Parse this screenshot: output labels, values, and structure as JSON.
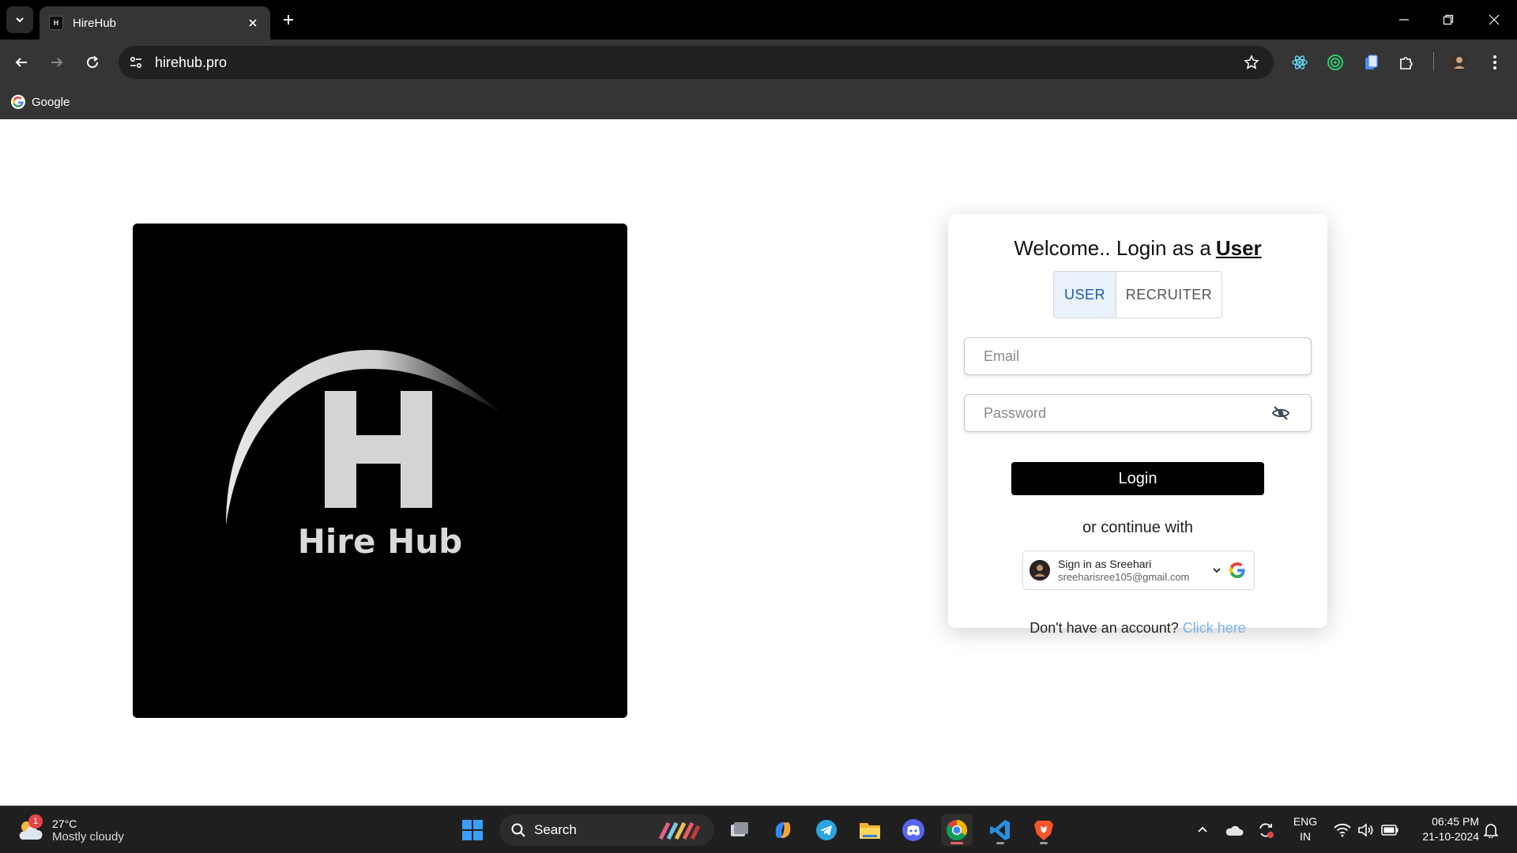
{
  "browser": {
    "tab_title": "HireHub",
    "tab_favicon_text": "H",
    "url": "hirehub.pro",
    "bookmarks": [
      {
        "label": "Google"
      }
    ],
    "icons": {
      "tab_menu": "chevron-down-icon",
      "tab_close": "close-icon",
      "new_tab": "plus-icon",
      "back": "arrow-left-icon",
      "forward": "arrow-right-icon",
      "reload": "reload-icon",
      "site_info": "tune-icon",
      "bookmark_star": "star-icon",
      "extensions": [
        "react-devtools-icon",
        "target-extension-icon",
        "clipboard-extension-icon",
        "puzzle-icon",
        "profile-avatar-icon",
        "kebab-menu-icon"
      ],
      "window_controls": [
        "minimize-icon",
        "restore-icon",
        "close-icon"
      ]
    }
  },
  "page": {
    "hero": {
      "logo_letter": "H",
      "logo_text": "Hire Hub"
    },
    "login": {
      "heading_prefix": "Welcome.. Login as a",
      "heading_role": "User",
      "roles": [
        {
          "label": "USER",
          "selected": true
        },
        {
          "label": "RECRUITER",
          "selected": false
        }
      ],
      "email": {
        "placeholder": "Email",
        "value": ""
      },
      "password": {
        "placeholder": "Password",
        "value": ""
      },
      "password_toggle_icon": "eye-off-icon",
      "submit_label": "Login",
      "divider_text": "or continue with",
      "google": {
        "title": "Sign in as Sreehari",
        "email": "sreeharisree105@gmail.com"
      },
      "signup_prompt": "Don't have an account?",
      "signup_link": "Click here"
    }
  },
  "taskbar": {
    "weather": {
      "badge": "1",
      "temp": "27°C",
      "desc": "Mostly cloudy"
    },
    "search_label": "Search",
    "apps": [
      "windows-start-icon",
      "task-view-icon",
      "copilot-icon",
      "telegram-icon",
      "file-explorer-icon",
      "discord-icon",
      "chrome-icon",
      "vscode-icon",
      "brave-icon"
    ],
    "tray_icons": [
      "chevron-up-icon",
      "onedrive-icon",
      "sync-icon",
      "wifi-icon",
      "volume-icon",
      "battery-icon",
      "notification-bell-icon"
    ],
    "lang_line1": "ENG",
    "lang_line2": "IN",
    "time": "06:45 PM",
    "date": "21-10-2024"
  },
  "colors": {
    "accent": "#1d5fa8",
    "link": "#7ab3e8",
    "login_button": "#000000",
    "chrome_bg": "#353535"
  }
}
